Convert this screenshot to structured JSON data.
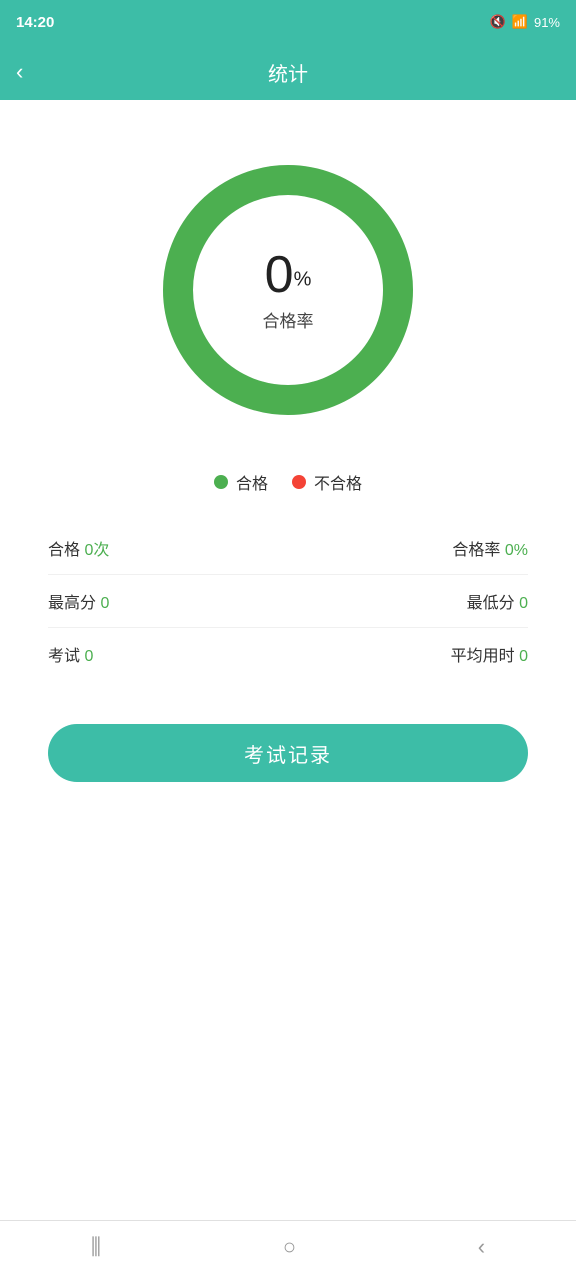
{
  "statusBar": {
    "time": "14:20",
    "battery": "91%"
  },
  "header": {
    "backLabel": "‹",
    "title": "统计"
  },
  "chart": {
    "value": "0",
    "percentSymbol": "%",
    "label": "合格率",
    "progressPercent": 0,
    "strokeColor": "#4caf50",
    "bgColor": "#4caf50",
    "trackColor": "#e8e8e8"
  },
  "legend": [
    {
      "label": "合格",
      "colorClass": "legend-dot-green"
    },
    {
      "label": "不合格",
      "colorClass": "legend-dot-red"
    }
  ],
  "stats": [
    {
      "left": {
        "label": "合格",
        "value": "0次",
        "valueColor": "green"
      },
      "right": {
        "label": "合格率",
        "value": "0%",
        "valueColor": "green"
      }
    },
    {
      "left": {
        "label": "最高分",
        "value": "0",
        "valueColor": "green"
      },
      "right": {
        "label": "最低分",
        "value": "0",
        "valueColor": "green"
      }
    },
    {
      "left": {
        "label": "考试",
        "value": "0",
        "valueColor": "green"
      },
      "right": {
        "label": "平均用时",
        "value": "0",
        "valueColor": "green"
      }
    }
  ],
  "examRecordButton": "考试记录",
  "bottomNav": {
    "icons": [
      "menu",
      "home",
      "back"
    ]
  }
}
